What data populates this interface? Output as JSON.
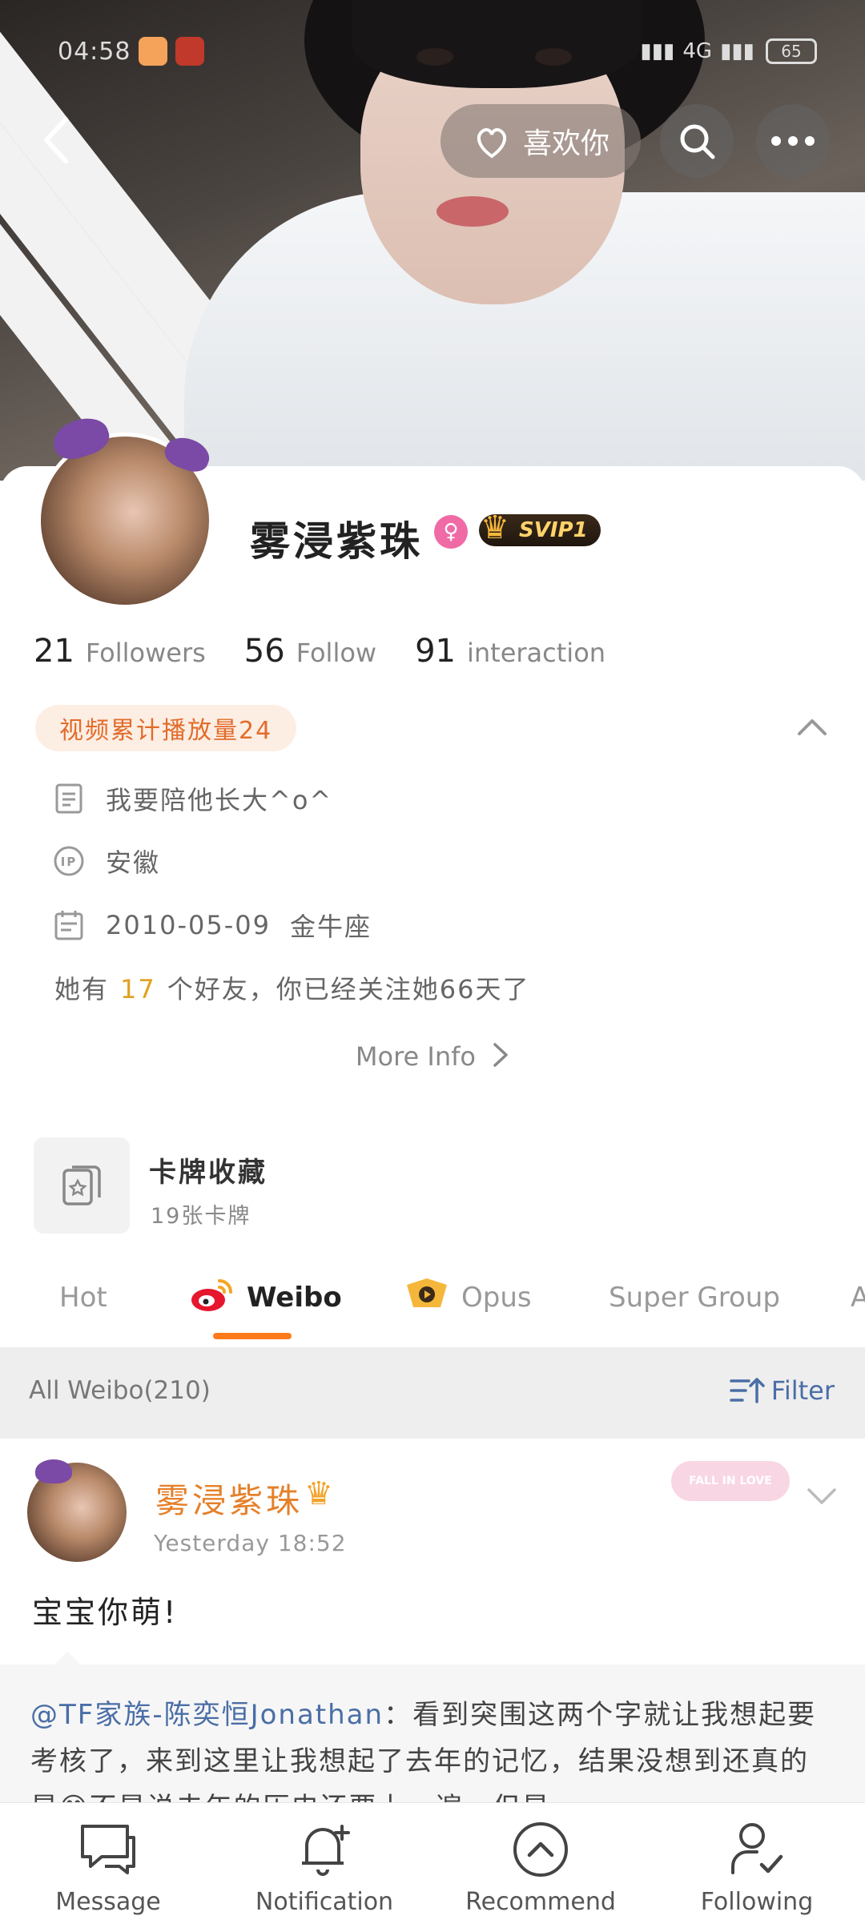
{
  "status_bar": {
    "time": "04:58",
    "signal": "4G",
    "battery": "65"
  },
  "header": {
    "like_label": "喜欢你"
  },
  "profile": {
    "name": "雾浸紫珠",
    "svip": "SVIP1",
    "stats": [
      {
        "num": "21",
        "label": "Followers"
      },
      {
        "num": "56",
        "label": "Follow"
      },
      {
        "num": "91",
        "label": "interaction"
      }
    ],
    "badge": "视频累计播放量24",
    "bio": "我要陪他长大^o^",
    "ip": "安徽",
    "birthday": "2010-05-09",
    "zodiac": "金牛座",
    "friends_prefix": "她有",
    "friends_count": "17",
    "friends_suffix": "个好友，你已经关注她66天了",
    "more_info": "More Info"
  },
  "card_collection": {
    "title": "卡牌收藏",
    "subtitle": "19张卡牌"
  },
  "tabs": [
    {
      "label": "Hot"
    },
    {
      "label": "Weibo"
    },
    {
      "label": "Opus"
    },
    {
      "label": "Super Group"
    },
    {
      "label": "A"
    }
  ],
  "filter_bar": {
    "count": "All Weibo(210)",
    "filter": "Filter"
  },
  "post": {
    "author": "雾浸紫珠",
    "time": "Yesterday 18:52",
    "sticker": "FALL IN LOVE",
    "text": "宝宝你萌!",
    "repost_mention": "@TF家族-陈奕恒Jonathan",
    "repost_text": "：看到突围这两个字就让我想起要考核了，来到这里让我想起了去年的记忆，结果没想到还真的是😄不是说去年的历史还要上一遍，但是"
  },
  "bottom_nav": [
    {
      "label": "Message",
      "icon": "message-icon"
    },
    {
      "label": "Notification",
      "icon": "bell-plus-icon"
    },
    {
      "label": "Recommend",
      "icon": "recommend-icon"
    },
    {
      "label": "Following",
      "icon": "person-check-icon"
    }
  ],
  "colors": {
    "accent": "#ff7a1a",
    "link": "#4a6ea6",
    "vip_name": "#e5802a"
  }
}
